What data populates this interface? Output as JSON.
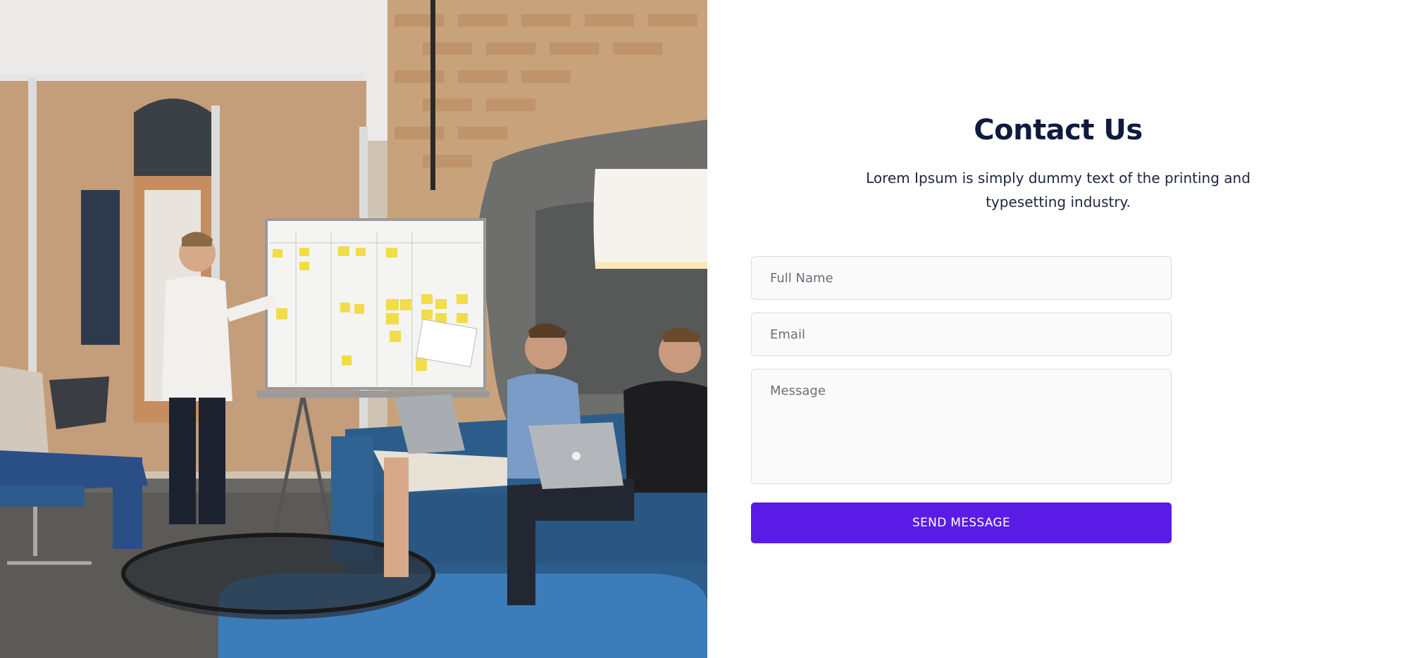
{
  "contact": {
    "title": "Contact Us",
    "subtitle_line1": "Lorem Ipsum is simply dummy text of the printing and",
    "subtitle_line2": "typesetting industry.",
    "form": {
      "full_name_placeholder": "Full Name",
      "email_placeholder": "Email",
      "message_placeholder": "Message",
      "submit_label": "SEND MESSAGE"
    }
  },
  "colors": {
    "accent": "#5a1be6",
    "title": "#0f1b3d",
    "field_border": "#dcdcdc",
    "field_background": "#fafafa"
  }
}
